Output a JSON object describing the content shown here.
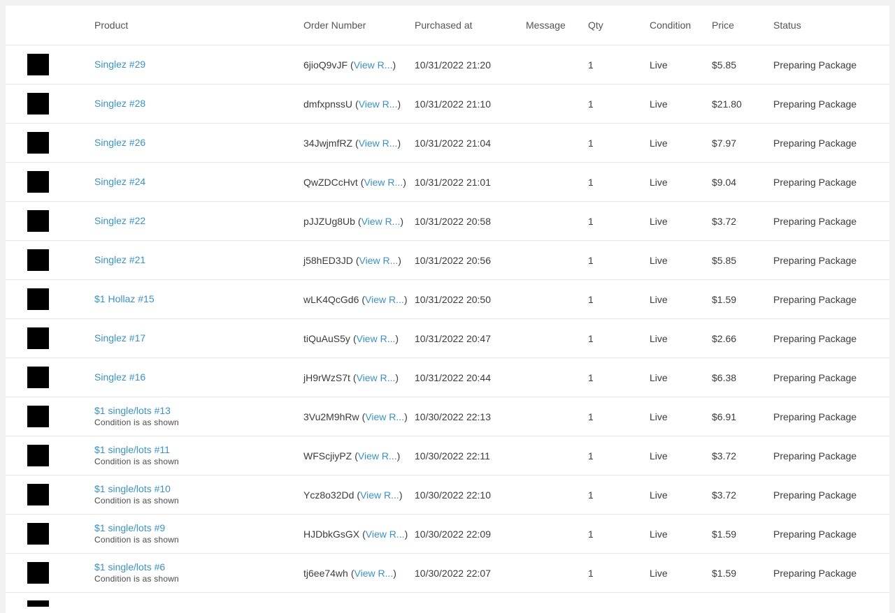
{
  "table": {
    "columns": {
      "product": "Product",
      "order_number": "Order Number",
      "purchased_at": "Purchased at",
      "message": "Message",
      "qty": "Qty",
      "condition": "Condition",
      "price": "Price",
      "status": "Status"
    },
    "view_label": "View R...",
    "rows": [
      {
        "product": "Singlez #29",
        "subtitle": "",
        "order": "6jioQ9vJF",
        "date": "10/31/2022 21:20",
        "message": "",
        "qty": "1",
        "condition": "Live",
        "price": "$5.85",
        "status": "Preparing Package"
      },
      {
        "product": "Singlez #28",
        "subtitle": "",
        "order": "dmfxpnssU",
        "date": "10/31/2022 21:10",
        "message": "",
        "qty": "1",
        "condition": "Live",
        "price": "$21.80",
        "status": "Preparing Package"
      },
      {
        "product": "Singlez #26",
        "subtitle": "",
        "order": "34JwjmfRZ",
        "date": "10/31/2022 21:04",
        "message": "",
        "qty": "1",
        "condition": "Live",
        "price": "$7.97",
        "status": "Preparing Package"
      },
      {
        "product": "Singlez #24",
        "subtitle": "",
        "order": "QwZDCcHvt",
        "date": "10/31/2022 21:01",
        "message": "",
        "qty": "1",
        "condition": "Live",
        "price": "$9.04",
        "status": "Preparing Package"
      },
      {
        "product": "Singlez #22",
        "subtitle": "",
        "order": "pJJZUg8Ub",
        "date": "10/31/2022 20:58",
        "message": "",
        "qty": "1",
        "condition": "Live",
        "price": "$3.72",
        "status": "Preparing Package"
      },
      {
        "product": "Singlez #21",
        "subtitle": "",
        "order": "j58hED3JD",
        "date": "10/31/2022 20:56",
        "message": "",
        "qty": "1",
        "condition": "Live",
        "price": "$5.85",
        "status": "Preparing Package"
      },
      {
        "product": "$1 Hollaz #15",
        "subtitle": "",
        "order": "wLK4QcGd6",
        "date": "10/31/2022 20:50",
        "message": "",
        "qty": "1",
        "condition": "Live",
        "price": "$1.59",
        "status": "Preparing Package"
      },
      {
        "product": "Singlez #17",
        "subtitle": "",
        "order": "tiQuAuS5y",
        "date": "10/31/2022 20:47",
        "message": "",
        "qty": "1",
        "condition": "Live",
        "price": "$2.66",
        "status": "Preparing Package"
      },
      {
        "product": "Singlez #16",
        "subtitle": "",
        "order": "jH9rWzS7t",
        "date": "10/31/2022 20:44",
        "message": "",
        "qty": "1",
        "condition": "Live",
        "price": "$6.38",
        "status": "Preparing Package"
      },
      {
        "product": "$1 single/lots #13",
        "subtitle": "Condition is as shown",
        "order": "3Vu2M9hRw",
        "date": "10/30/2022 22:13",
        "message": "",
        "qty": "1",
        "condition": "Live",
        "price": "$6.91",
        "status": "Preparing Package"
      },
      {
        "product": "$1 single/lots #11",
        "subtitle": "Condition is as shown",
        "order": "WFScjiyPZ",
        "date": "10/30/2022 22:11",
        "message": "",
        "qty": "1",
        "condition": "Live",
        "price": "$3.72",
        "status": "Preparing Package"
      },
      {
        "product": "$1 single/lots #10",
        "subtitle": "Condition is as shown",
        "order": "Ycz8o32Dd",
        "date": "10/30/2022 22:10",
        "message": "",
        "qty": "1",
        "condition": "Live",
        "price": "$3.72",
        "status": "Preparing Package"
      },
      {
        "product": "$1 single/lots #9",
        "subtitle": "Condition is as shown",
        "order": "HJDbkGsGX",
        "date": "10/30/2022 22:09",
        "message": "",
        "qty": "1",
        "condition": "Live",
        "price": "$1.59",
        "status": "Preparing Package"
      },
      {
        "product": "$1 single/lots #6",
        "subtitle": "Condition is as shown",
        "order": "tj6ee74wh",
        "date": "10/30/2022 22:07",
        "message": "",
        "qty": "1",
        "condition": "Live",
        "price": "$1.59",
        "status": "Preparing Package"
      }
    ]
  },
  "colors": {
    "link": "#3a92c4",
    "thumbnail": "#000000",
    "divider": "#e6e6e6",
    "page_background": "#f2f2f2"
  }
}
